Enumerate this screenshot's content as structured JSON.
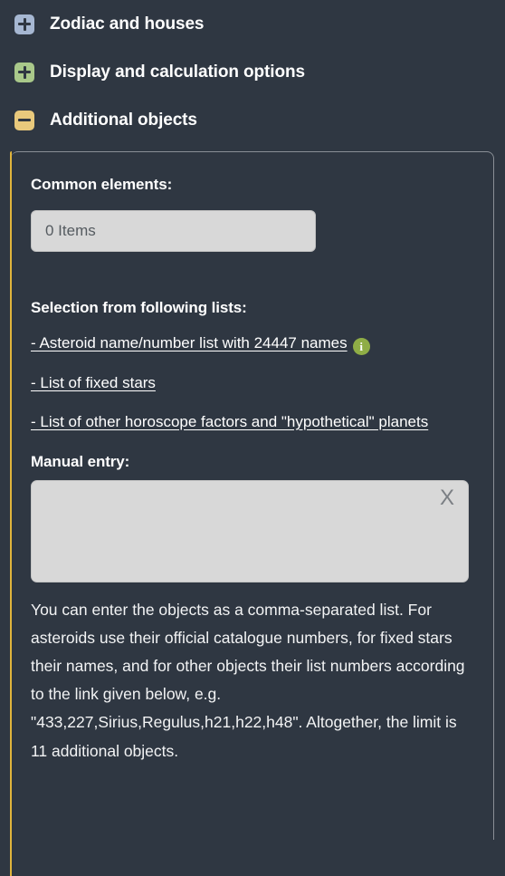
{
  "accordion": {
    "sections": [
      {
        "label": "Zodiac and houses",
        "icon": "plus-icon",
        "state": "collapsed",
        "color": "#a6b7d2"
      },
      {
        "label": "Display and calculation options",
        "icon": "plus-icon",
        "state": "collapsed",
        "color": "#a9c88a"
      },
      {
        "label": "Additional objects",
        "icon": "minus-icon",
        "state": "expanded",
        "color": "#e9c97c"
      }
    ]
  },
  "panel": {
    "accent_color": "#e0b43c",
    "common_elements": {
      "label": "Common elements:",
      "select_value": "0 Items"
    },
    "selection_lists": {
      "label": "Selection from following lists:",
      "links": [
        {
          "text": "- Asteroid name/number list with 24447 names",
          "has_info": true
        },
        {
          "text": "- List of fixed stars",
          "has_info": false
        },
        {
          "text": "- List of other horoscope factors and \"hypothetical\" planets",
          "has_info": false
        }
      ],
      "info_glyph": "i"
    },
    "manual_entry": {
      "label": "Manual entry:",
      "value": "",
      "clear_label": "X"
    },
    "help_text": "You can enter the objects as a comma-separated list. For asteroids use their official catalogue numbers, for fixed stars their names, and for other objects their list numbers according to the link given below, e.g. \"433,227,Sirius,Regulus,h21,h22,h48\". Altogether, the limit is 11 additional objects."
  }
}
